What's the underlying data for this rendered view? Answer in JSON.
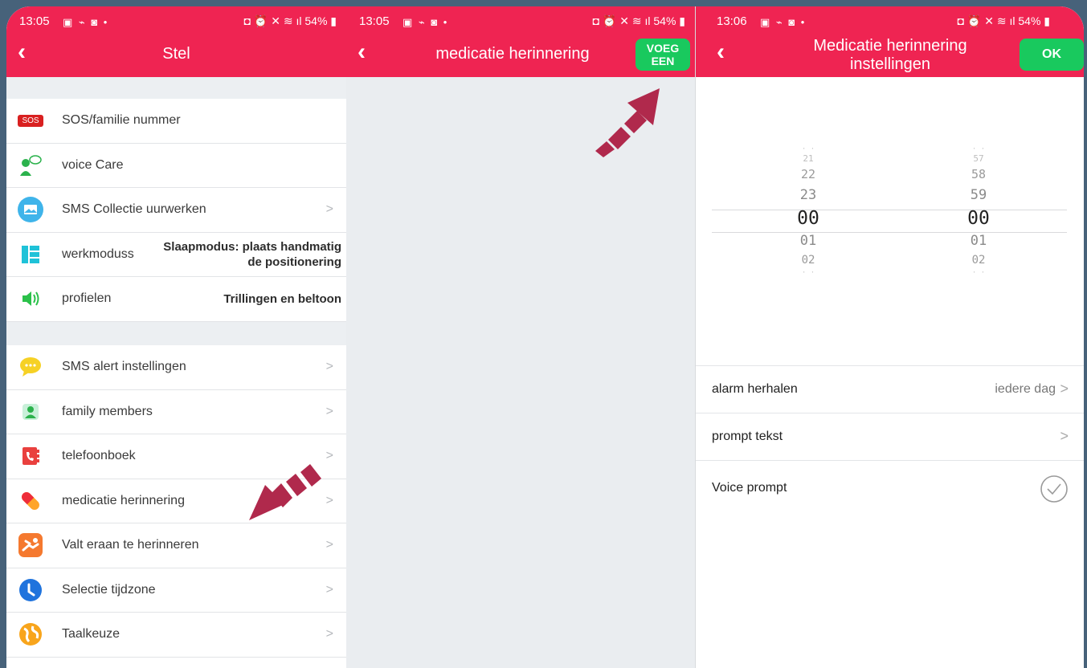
{
  "colors": {
    "header": "#ef2452",
    "ok": "#19c95e",
    "arrow": "#b0294c",
    "background": "#47627a"
  },
  "status": [
    {
      "time": "13:05",
      "battery": "54%"
    },
    {
      "time": "13:05",
      "battery": "54%"
    },
    {
      "time": "13:06",
      "battery": "54%"
    }
  ],
  "panel1": {
    "title": "Stel",
    "group1": [
      {
        "icon": "sos-icon",
        "badge": "SOS",
        "label": "SOS/familie nummer"
      },
      {
        "icon": "voice-care-icon",
        "label": "voice Care"
      },
      {
        "icon": "sms-icon",
        "label": "SMS Collectie uurwerken",
        "chevron": ">"
      },
      {
        "icon": "work-mode-icon",
        "label": "werkmoduss",
        "value_line1": "Slaapmodus: plaats handmatig",
        "value_line2": "de positionering"
      },
      {
        "icon": "speaker-icon",
        "label": "profielen",
        "value": "Trillingen en beltoon"
      }
    ],
    "group2": [
      {
        "icon": "chat-bubble-icon",
        "label": "SMS alert instellingen",
        "chevron": ">"
      },
      {
        "icon": "family-icon",
        "label": "family members",
        "chevron": ">"
      },
      {
        "icon": "phonebook-icon",
        "label": "telefoonboek",
        "chevron": ">"
      },
      {
        "icon": "pill-icon",
        "label": "medicatie herinnering",
        "chevron": ">"
      },
      {
        "icon": "fall-icon",
        "label": "Valt eraan te herinneren",
        "chevron": ">"
      },
      {
        "icon": "clock-icon",
        "label": "Selectie tijdzone",
        "chevron": ">"
      },
      {
        "icon": "globe-icon",
        "label": "Taalkeuze",
        "chevron": ">"
      }
    ]
  },
  "panel2": {
    "title": "medicatie herinnering",
    "add_line1": "VOEG",
    "add_line2": "EEN"
  },
  "panel3": {
    "title_line1": "Medicatie herinnering",
    "title_line2": "instellingen",
    "ok": "OK",
    "hours": [
      "21",
      "22",
      "23",
      "00",
      "01",
      "02"
    ],
    "minutes": [
      "57",
      "58",
      "59",
      "00",
      "01",
      "02"
    ],
    "settings": {
      "repeat_label": "alarm herhalen",
      "repeat_value": "iedere dag",
      "prompt_label": "prompt tekst",
      "voice_label": "Voice prompt",
      "chevron": ">"
    }
  }
}
